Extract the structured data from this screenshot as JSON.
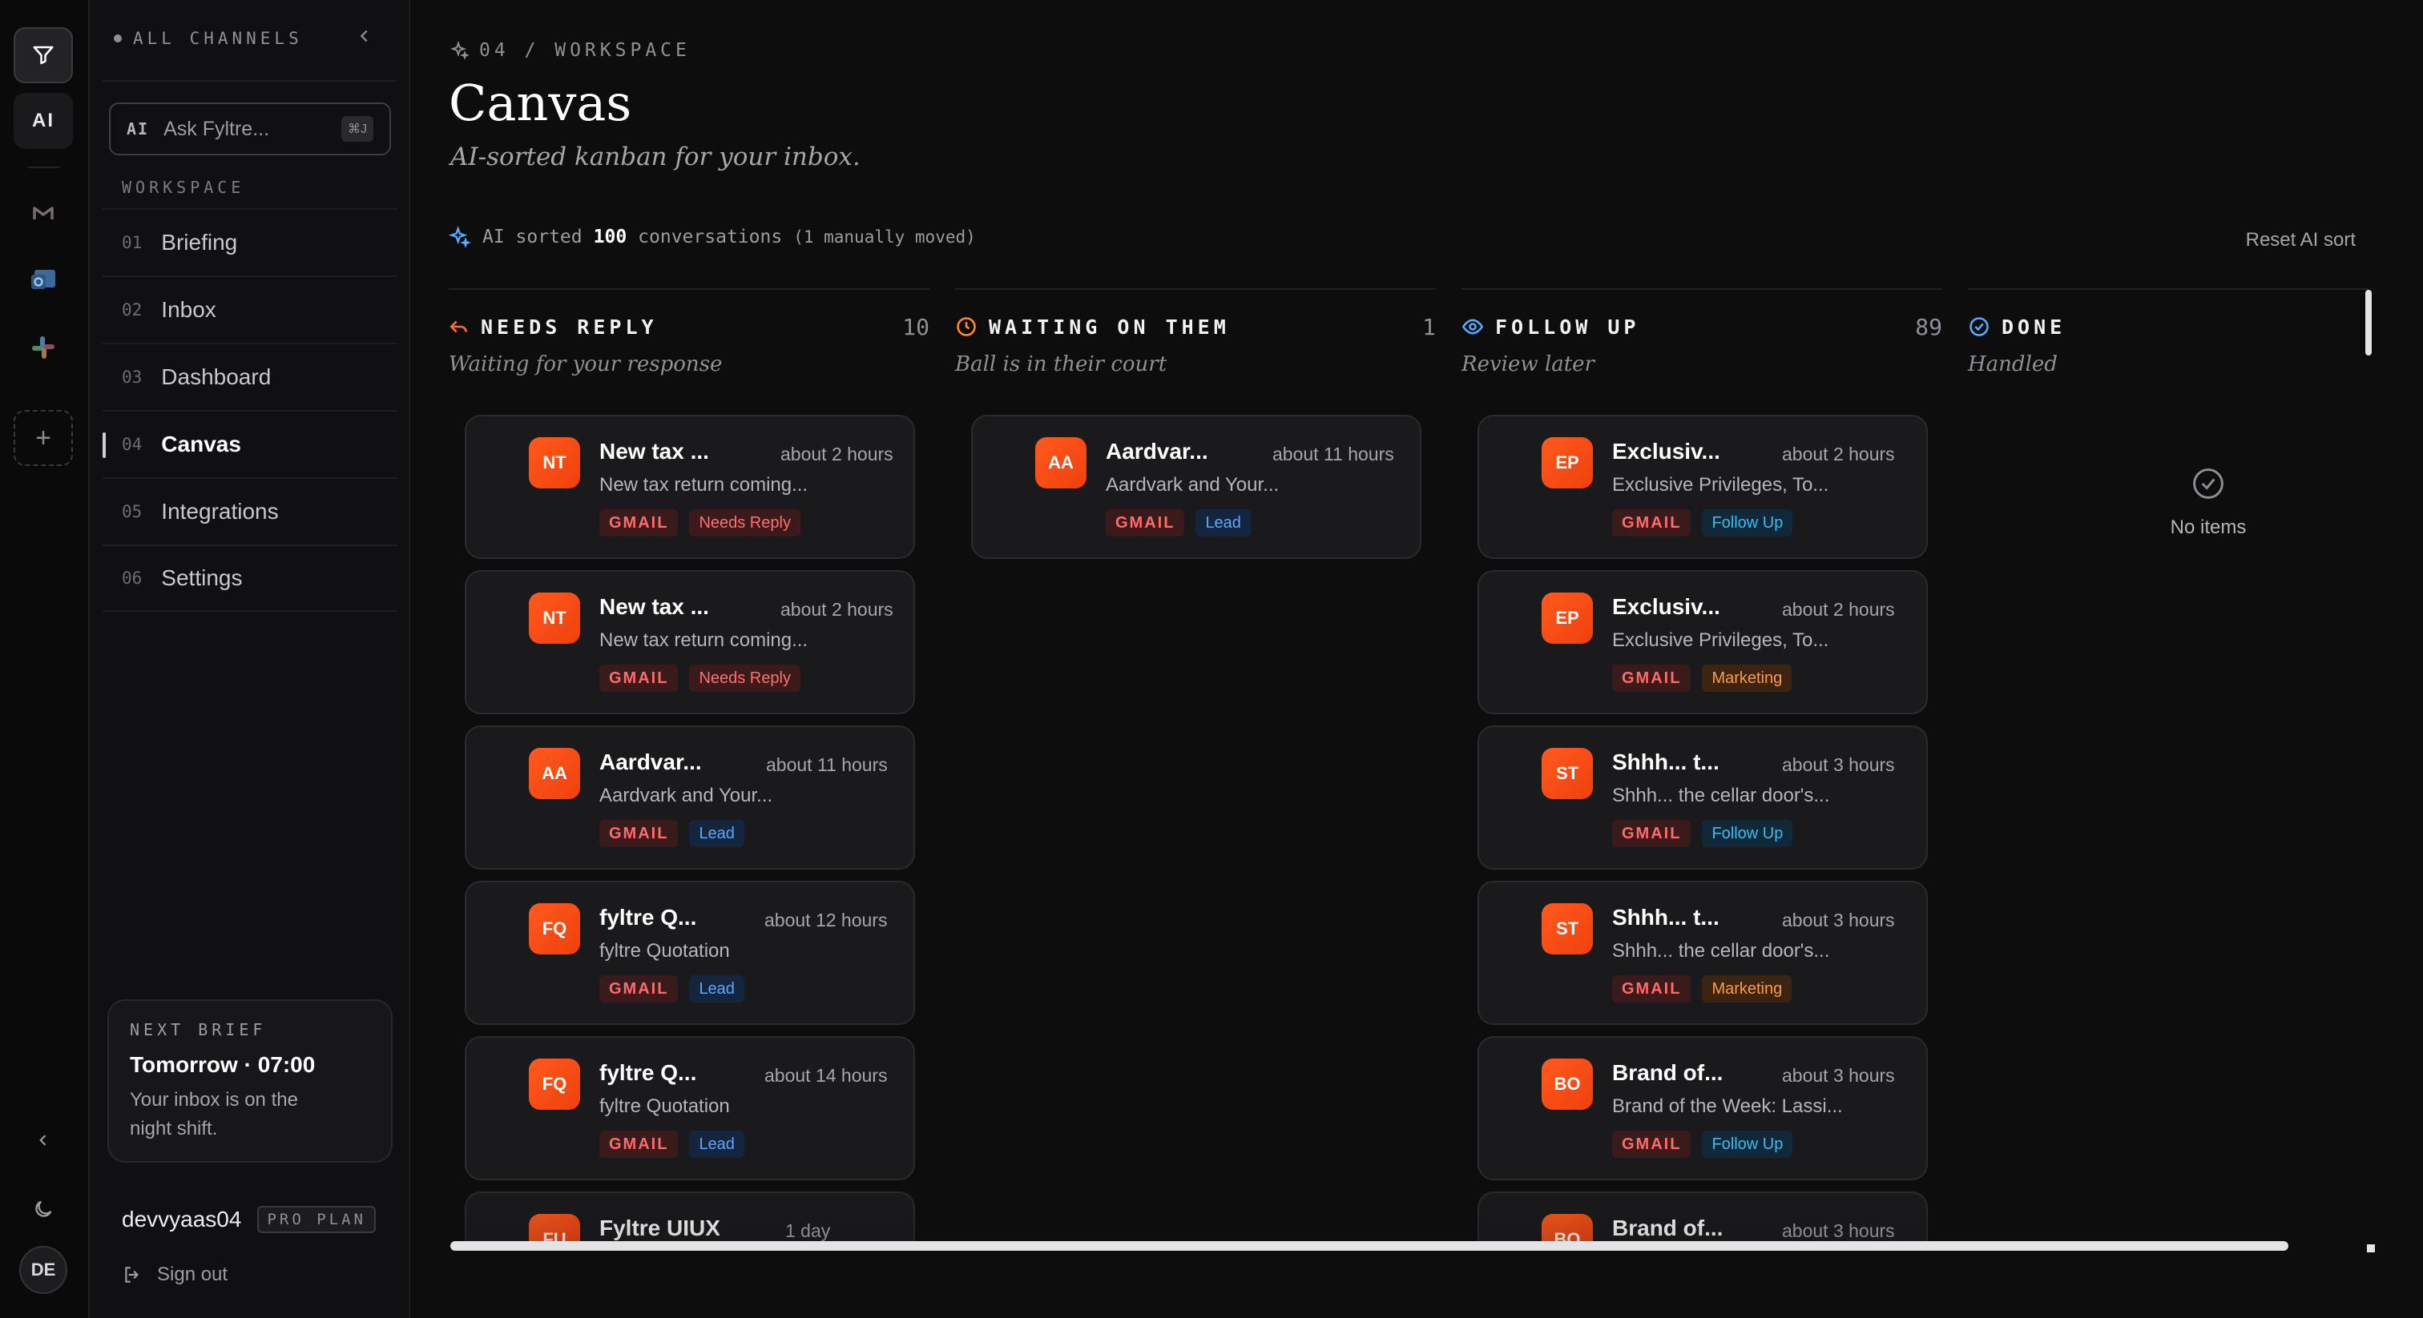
{
  "rail": {
    "ai_label": "AI",
    "avatar_initials": "DE"
  },
  "sidebar": {
    "header": "ALL CHANNELS",
    "ask": {
      "tag": "AI",
      "placeholder": "Ask Fyltre...",
      "shortcut": "⌘J"
    },
    "section_label": "WORKSPACE",
    "items": [
      {
        "num": "01",
        "label": "Briefing"
      },
      {
        "num": "02",
        "label": "Inbox"
      },
      {
        "num": "03",
        "label": "Dashboard"
      },
      {
        "num": "04",
        "label": "Canvas",
        "active": true
      },
      {
        "num": "05",
        "label": "Integrations"
      },
      {
        "num": "06",
        "label": "Settings"
      }
    ],
    "brief": {
      "kicker": "NEXT BRIEF",
      "time": "Tomorrow · 07:00",
      "desc_line1": "Your inbox is on the",
      "desc_line2": "night shift."
    },
    "user": {
      "name": "devvyaas04",
      "plan": "PRO PLAN"
    },
    "signout": "Sign out"
  },
  "main": {
    "breadcrumb": "04 / WORKSPACE",
    "title": "Canvas",
    "subtitle": "AI-sorted kanban for your inbox.",
    "sort": {
      "prefix": "AI sorted",
      "count": "100",
      "suffix": "conversations",
      "note": "(1 manually moved)"
    },
    "reset": "Reset AI sort"
  },
  "columns": [
    {
      "name": "NEEDS REPLY",
      "count": "10",
      "sub": "Waiting for your response",
      "icon": "reply-icon",
      "cards": [
        {
          "initials": "NT",
          "subject": "New tax ...",
          "time": "about 2 hours",
          "preview": "New tax return coming...",
          "tags": [
            {
              "t": "GMAIL",
              "c": "gmail"
            },
            {
              "t": "Needs Reply",
              "c": "red"
            }
          ]
        },
        {
          "initials": "NT",
          "subject": "New tax ...",
          "time": "about 2 hours",
          "preview": "New tax return coming...",
          "tags": [
            {
              "t": "GMAIL",
              "c": "gmail"
            },
            {
              "t": "Needs Reply",
              "c": "red"
            }
          ]
        },
        {
          "initials": "AA",
          "subject": "Aardvar...",
          "time": "about 11 hours",
          "preview": "Aardvark and Your...",
          "tags": [
            {
              "t": "GMAIL",
              "c": "gmail"
            },
            {
              "t": "Lead",
              "c": "blue"
            }
          ]
        },
        {
          "initials": "FQ",
          "subject": "fyltre Q...",
          "time": "about 12 hours",
          "preview": "fyltre Quotation",
          "tags": [
            {
              "t": "GMAIL",
              "c": "gmail"
            },
            {
              "t": "Lead",
              "c": "blue"
            }
          ]
        },
        {
          "initials": "FQ",
          "subject": "fyltre Q...",
          "time": "about 14 hours",
          "preview": "fyltre Quotation",
          "tags": [
            {
              "t": "GMAIL",
              "c": "gmail"
            },
            {
              "t": "Lead",
              "c": "blue"
            }
          ]
        },
        {
          "initials": "FU",
          "subject": "Fyltre UIUX",
          "time": "1 day",
          "preview": "",
          "tags": []
        }
      ]
    },
    {
      "name": "WAITING ON THEM",
      "count": "1",
      "sub": "Ball is in their court",
      "icon": "clock-icon",
      "cards": [
        {
          "initials": "AA",
          "subject": "Aardvar...",
          "time": "about 11 hours",
          "preview": "Aardvark and Your...",
          "tags": [
            {
              "t": "GMAIL",
              "c": "gmail"
            },
            {
              "t": "Lead",
              "c": "blue"
            }
          ]
        }
      ]
    },
    {
      "name": "FOLLOW UP",
      "count": "89",
      "sub": "Review later",
      "icon": "eye-icon",
      "cards": [
        {
          "initials": "EP",
          "subject": "Exclusiv...",
          "time": "about 2 hours",
          "preview": "Exclusive Privileges, To...",
          "tags": [
            {
              "t": "GMAIL",
              "c": "gmail"
            },
            {
              "t": "Follow Up",
              "c": "cyan"
            }
          ]
        },
        {
          "initials": "EP",
          "subject": "Exclusiv...",
          "time": "about 2 hours",
          "preview": "Exclusive Privileges, To...",
          "tags": [
            {
              "t": "GMAIL",
              "c": "gmail"
            },
            {
              "t": "Marketing",
              "c": "orange"
            }
          ]
        },
        {
          "initials": "ST",
          "subject": "Shhh... t...",
          "time": "about 3 hours",
          "preview": "Shhh... the cellar door's...",
          "tags": [
            {
              "t": "GMAIL",
              "c": "gmail"
            },
            {
              "t": "Follow Up",
              "c": "cyan"
            }
          ]
        },
        {
          "initials": "ST",
          "subject": "Shhh... t...",
          "time": "about 3 hours",
          "preview": "Shhh... the cellar door's...",
          "tags": [
            {
              "t": "GMAIL",
              "c": "gmail"
            },
            {
              "t": "Marketing",
              "c": "orange"
            }
          ]
        },
        {
          "initials": "BO",
          "subject": "Brand of...",
          "time": "about 3 hours",
          "preview": "Brand of the Week: Lassi...",
          "tags": [
            {
              "t": "GMAIL",
              "c": "gmail"
            },
            {
              "t": "Follow Up",
              "c": "cyan"
            }
          ]
        },
        {
          "initials": "BO",
          "subject": "Brand of...",
          "time": "about 3 hours",
          "preview": "",
          "tags": []
        }
      ]
    },
    {
      "name": "DONE",
      "count": "",
      "sub": "Handled",
      "icon": "check-circle-icon",
      "cards": [],
      "empty": "No items"
    }
  ],
  "colors": {
    "accent": "#f0400c",
    "bg": "#0d0d0e",
    "card": "#1a1a1c"
  }
}
